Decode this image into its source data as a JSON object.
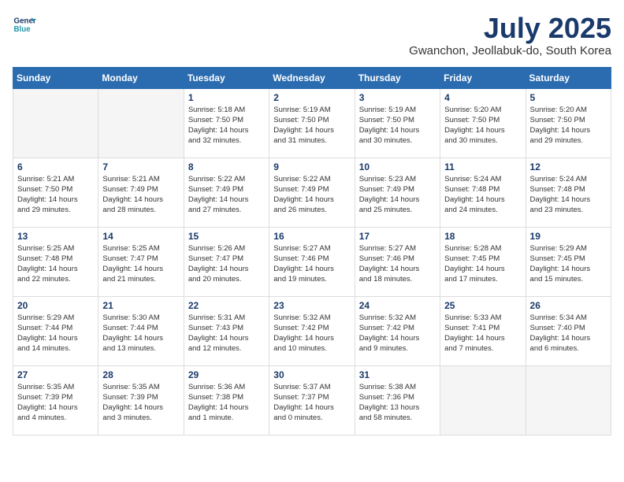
{
  "header": {
    "logo_line1": "General",
    "logo_line2": "Blue",
    "month_title": "July 2025",
    "location": "Gwanchon, Jeollabuk-do, South Korea"
  },
  "weekdays": [
    "Sunday",
    "Monday",
    "Tuesday",
    "Wednesday",
    "Thursday",
    "Friday",
    "Saturday"
  ],
  "weeks": [
    [
      {
        "day": "",
        "info": ""
      },
      {
        "day": "",
        "info": ""
      },
      {
        "day": "1",
        "info": "Sunrise: 5:18 AM\nSunset: 7:50 PM\nDaylight: 14 hours\nand 32 minutes."
      },
      {
        "day": "2",
        "info": "Sunrise: 5:19 AM\nSunset: 7:50 PM\nDaylight: 14 hours\nand 31 minutes."
      },
      {
        "day": "3",
        "info": "Sunrise: 5:19 AM\nSunset: 7:50 PM\nDaylight: 14 hours\nand 30 minutes."
      },
      {
        "day": "4",
        "info": "Sunrise: 5:20 AM\nSunset: 7:50 PM\nDaylight: 14 hours\nand 30 minutes."
      },
      {
        "day": "5",
        "info": "Sunrise: 5:20 AM\nSunset: 7:50 PM\nDaylight: 14 hours\nand 29 minutes."
      }
    ],
    [
      {
        "day": "6",
        "info": "Sunrise: 5:21 AM\nSunset: 7:50 PM\nDaylight: 14 hours\nand 29 minutes."
      },
      {
        "day": "7",
        "info": "Sunrise: 5:21 AM\nSunset: 7:49 PM\nDaylight: 14 hours\nand 28 minutes."
      },
      {
        "day": "8",
        "info": "Sunrise: 5:22 AM\nSunset: 7:49 PM\nDaylight: 14 hours\nand 27 minutes."
      },
      {
        "day": "9",
        "info": "Sunrise: 5:22 AM\nSunset: 7:49 PM\nDaylight: 14 hours\nand 26 minutes."
      },
      {
        "day": "10",
        "info": "Sunrise: 5:23 AM\nSunset: 7:49 PM\nDaylight: 14 hours\nand 25 minutes."
      },
      {
        "day": "11",
        "info": "Sunrise: 5:24 AM\nSunset: 7:48 PM\nDaylight: 14 hours\nand 24 minutes."
      },
      {
        "day": "12",
        "info": "Sunrise: 5:24 AM\nSunset: 7:48 PM\nDaylight: 14 hours\nand 23 minutes."
      }
    ],
    [
      {
        "day": "13",
        "info": "Sunrise: 5:25 AM\nSunset: 7:48 PM\nDaylight: 14 hours\nand 22 minutes."
      },
      {
        "day": "14",
        "info": "Sunrise: 5:25 AM\nSunset: 7:47 PM\nDaylight: 14 hours\nand 21 minutes."
      },
      {
        "day": "15",
        "info": "Sunrise: 5:26 AM\nSunset: 7:47 PM\nDaylight: 14 hours\nand 20 minutes."
      },
      {
        "day": "16",
        "info": "Sunrise: 5:27 AM\nSunset: 7:46 PM\nDaylight: 14 hours\nand 19 minutes."
      },
      {
        "day": "17",
        "info": "Sunrise: 5:27 AM\nSunset: 7:46 PM\nDaylight: 14 hours\nand 18 minutes."
      },
      {
        "day": "18",
        "info": "Sunrise: 5:28 AM\nSunset: 7:45 PM\nDaylight: 14 hours\nand 17 minutes."
      },
      {
        "day": "19",
        "info": "Sunrise: 5:29 AM\nSunset: 7:45 PM\nDaylight: 14 hours\nand 15 minutes."
      }
    ],
    [
      {
        "day": "20",
        "info": "Sunrise: 5:29 AM\nSunset: 7:44 PM\nDaylight: 14 hours\nand 14 minutes."
      },
      {
        "day": "21",
        "info": "Sunrise: 5:30 AM\nSunset: 7:44 PM\nDaylight: 14 hours\nand 13 minutes."
      },
      {
        "day": "22",
        "info": "Sunrise: 5:31 AM\nSunset: 7:43 PM\nDaylight: 14 hours\nand 12 minutes."
      },
      {
        "day": "23",
        "info": "Sunrise: 5:32 AM\nSunset: 7:42 PM\nDaylight: 14 hours\nand 10 minutes."
      },
      {
        "day": "24",
        "info": "Sunrise: 5:32 AM\nSunset: 7:42 PM\nDaylight: 14 hours\nand 9 minutes."
      },
      {
        "day": "25",
        "info": "Sunrise: 5:33 AM\nSunset: 7:41 PM\nDaylight: 14 hours\nand 7 minutes."
      },
      {
        "day": "26",
        "info": "Sunrise: 5:34 AM\nSunset: 7:40 PM\nDaylight: 14 hours\nand 6 minutes."
      }
    ],
    [
      {
        "day": "27",
        "info": "Sunrise: 5:35 AM\nSunset: 7:39 PM\nDaylight: 14 hours\nand 4 minutes."
      },
      {
        "day": "28",
        "info": "Sunrise: 5:35 AM\nSunset: 7:39 PM\nDaylight: 14 hours\nand 3 minutes."
      },
      {
        "day": "29",
        "info": "Sunrise: 5:36 AM\nSunset: 7:38 PM\nDaylight: 14 hours\nand 1 minute."
      },
      {
        "day": "30",
        "info": "Sunrise: 5:37 AM\nSunset: 7:37 PM\nDaylight: 14 hours\nand 0 minutes."
      },
      {
        "day": "31",
        "info": "Sunrise: 5:38 AM\nSunset: 7:36 PM\nDaylight: 13 hours\nand 58 minutes."
      },
      {
        "day": "",
        "info": ""
      },
      {
        "day": "",
        "info": ""
      }
    ]
  ]
}
